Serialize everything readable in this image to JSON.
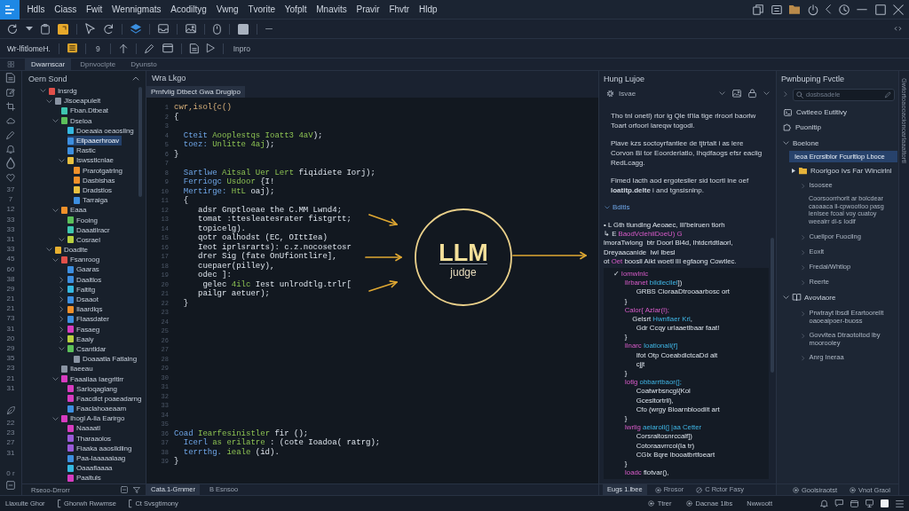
{
  "menu_bar": {
    "items": [
      "Hdls",
      "Ciass",
      "Fwit",
      "Wennigmats",
      "Acodiltyg",
      "Vwng",
      "Tvorite",
      "Yofplt",
      "Mnavits",
      "Pravir",
      "Fhvtr",
      "Hldp"
    ]
  },
  "toolbar": {
    "label": "Wr-lfitlomeH.",
    "counter": "9",
    "action": "Inpro"
  },
  "view_tabs": [
    {
      "label": "Dwarnscar",
      "selected": true
    },
    {
      "label": "Dpnvoclpte",
      "selected": false
    },
    {
      "label": "Dyunsto",
      "selected": false
    }
  ],
  "rail": {
    "numbers": [
      "37",
      "7",
      "12",
      "33",
      "33",
      "31",
      "33",
      "45",
      "60",
      "38",
      "29",
      "21",
      "21",
      "73",
      "31",
      "20",
      "29",
      "35",
      "23",
      "21",
      "31"
    ],
    "more_numbers": [
      "22",
      "23",
      "27",
      "31"
    ],
    "footer": "0 r"
  },
  "explorer": {
    "title": "Oern Sond",
    "footer": "Rseoo-Drrorr",
    "tree": [
      {
        "label": "Insrdg",
        "color": "#e0504a",
        "selected": false,
        "expanded": true,
        "children": [
          {
            "label": "Jlsoeapulelt",
            "color": "#8a94a3",
            "selected": false,
            "expanded": true,
            "children": [
              {
                "label": "Fban.Dtbeat",
                "color": "#3ec6b0",
                "selected": false
              },
              {
                "label": "Dseloa",
                "color": "#5cbf5a",
                "selected": false,
                "expanded": true,
                "children": [
                  {
                    "label": "Doeaaia oeaosllng",
                    "color": "#35b8e0",
                    "selected": false
                  },
                  {
                    "label": "Ellpaaerhroav",
                    "color": "#3d8fe0",
                    "selected": true
                  },
                  {
                    "label": "Rastic",
                    "color": "#3d8fe0",
                    "selected": false
                  },
                  {
                    "label": "Iswsstlcnlae",
                    "color": "#e8c040",
                    "selected": false,
                    "expanded": true,
                    "children": [
                      {
                        "label": "Prarotgatrlng",
                        "color": "#f0902a",
                        "selected": false
                      },
                      {
                        "label": "Dasbishas",
                        "color": "#f0902a",
                        "selected": false
                      },
                      {
                        "label": "Dradstlos",
                        "color": "#e8c040",
                        "selected": false
                      },
                      {
                        "label": "Tarraiga",
                        "color": "#3d8fe0",
                        "selected": false
                      }
                    ]
                  }
                ]
              },
              {
                "label": "Eaaa",
                "color": "#f0902a",
                "selected": false,
                "expanded": true,
                "children": [
                  {
                    "label": "Fooing",
                    "color": "#5cbf5a",
                    "selected": false
                  },
                  {
                    "label": "Daaatilracr",
                    "color": "#3ec6b0",
                    "selected": false
                  },
                  {
                    "label": "Cosrael",
                    "color": "#b8d040",
                    "selected": false,
                    "expanded": true
                  }
                ]
              }
            ]
          },
          {
            "label": "Doadlte",
            "color": "#e8b030",
            "selected": false,
            "expanded": true,
            "children": [
              {
                "label": "Fsanroog",
                "color": "#e0504a",
                "selected": false,
                "expanded": true,
                "children": [
                  {
                    "label": "Gaaras",
                    "color": "#3d8fe0",
                    "selected": false
                  },
                  {
                    "label": "Daaltlos",
                    "color": "#3d8fe0",
                    "selected": false,
                    "expanded": false
                  },
                  {
                    "label": "Faltitg",
                    "color": "#35b8e0",
                    "selected": false,
                    "expanded": false
                  },
                  {
                    "label": "Dsaaot",
                    "color": "#3d8fe0",
                    "selected": false,
                    "expanded": false
                  },
                  {
                    "label": "Ilaardlqs",
                    "color": "#f0902a",
                    "selected": false,
                    "expanded": false
                  },
                  {
                    "label": "Flaasdater",
                    "color": "#3d8fe0",
                    "selected": false,
                    "expanded": false
                  },
                  {
                    "label": "Fasaeg",
                    "color": "#d63cc0",
                    "selected": false,
                    "expanded": false
                  },
                  {
                    "label": "Eaaiy",
                    "color": "#b8d040",
                    "selected": false,
                    "expanded": false
                  },
                  {
                    "label": "Csantldar",
                    "color": "#5cbf5a",
                    "selected": false,
                    "expanded": true,
                    "children": [
                      {
                        "label": "Doaaatla Fatlalng",
                        "color": "#8a94a3",
                        "selected": false
                      }
                    ]
                  }
                ]
              },
              {
                "label": "Ilaeeau",
                "color": "#8a94a3",
                "selected": false
              },
              {
                "label": "Faaallaa Iaegrltlrr",
                "color": "#d63cc0",
                "selected": false,
                "expanded": true,
                "children": [
                  {
                    "label": "Sarloqaglang",
                    "color": "#d63cc0",
                    "selected": false
                  },
                  {
                    "label": "Faacdlct poaeadarng",
                    "color": "#d63cc0",
                    "selected": false
                  },
                  {
                    "label": "Faaclahoaeaam",
                    "color": "#3d8fe0",
                    "selected": false
                  }
                ]
              },
              {
                "label": "Ihogl A-lla Earirgo",
                "color": "#d63cc0",
                "selected": false,
                "expanded": true,
                "children": [
                  {
                    "label": "Naaaatl",
                    "color": "#d63cc0",
                    "selected": false
                  },
                  {
                    "label": "Tharaaolos",
                    "color": "#9a5ad8",
                    "selected": false
                  },
                  {
                    "label": "Fiaaka aaoslldling",
                    "color": "#9a5ad8",
                    "selected": false
                  },
                  {
                    "label": "Paa-Iaaaaalaag",
                    "color": "#3d8fe0",
                    "selected": false
                  },
                  {
                    "label": "Oaaaflaaaa",
                    "color": "#35b8e0",
                    "selected": false
                  },
                  {
                    "label": "Paaltuls",
                    "color": "#d63cc0",
                    "selected": false
                  }
                ]
              }
            ]
          }
        ]
      }
    ]
  },
  "editor": {
    "title": "Wra Lkgo",
    "tab": "Prnfvlig Dtbect Gwa Drugipo",
    "lines": [
      {
        "num": "1",
        "tokens": [
          {
            "text": "cwr,isol{c()",
            "kind": "acc"
          }
        ]
      },
      {
        "num": "2",
        "tokens": [
          {
            "text": "{",
            "kind": "pl"
          }
        ]
      },
      {
        "num": "3"
      },
      {
        "num": "4",
        "tokens": [
          {
            "text": "  Cteit ",
            "kind": "kw"
          },
          {
            "text": "Aooplestqs Ioatt3 4aV",
            "kind": "fn"
          },
          {
            "text": ");",
            "kind": "pl"
          }
        ]
      },
      {
        "num": "5",
        "tokens": [
          {
            "text": "  toez: ",
            "kind": "kw"
          },
          {
            "text": "Unlitte 4aj",
            "kind": "fn"
          },
          {
            "text": ");",
            "kind": "pl"
          }
        ]
      },
      {
        "num": "6",
        "tokens": [
          {
            "text": "}",
            "kind": "pl"
          }
        ]
      },
      {
        "num": "7"
      },
      {
        "num": "8",
        "tokens": [
          {
            "text": "  Sartlwe ",
            "kind": "kw"
          },
          {
            "text": "Aitsal Uer Lert",
            "kind": "fn"
          },
          {
            "text": " fiqidiete Iorj);",
            "kind": "pl"
          }
        ]
      },
      {
        "num": "9",
        "tokens": [
          {
            "text": "  Ferriogc ",
            "kind": "kw"
          },
          {
            "text": "Usdoor",
            "kind": "fn"
          },
          {
            "text": " {I!",
            "kind": "pl"
          }
        ]
      },
      {
        "num": "10",
        "tokens": [
          {
            "text": "  Mertirge: ",
            "kind": "kw"
          },
          {
            "text": "HtL",
            "kind": "fn"
          },
          {
            "text": " oaj);",
            "kind": "pl"
          }
        ]
      },
      {
        "num": "11",
        "tokens": [
          {
            "text": "  {",
            "kind": "pl"
          }
        ]
      },
      {
        "num": "12",
        "tokens": [
          {
            "text": "     adsr Gnptloeae the C.MM Lwnd4;",
            "kind": "pl"
          }
        ]
      },
      {
        "num": "13",
        "tokens": [
          {
            "text": "     tomat :ttesleatesrater fistgrtt;",
            "kind": "pl"
          }
        ]
      },
      {
        "num": "14",
        "tokens": [
          {
            "text": "     topicelg).",
            "kind": "pl"
          }
        ]
      },
      {
        "num": "15",
        "tokens": [
          {
            "text": "     qotr oalhodst (EC, OIttIea)",
            "kind": "pl"
          }
        ]
      },
      {
        "num": "16",
        "tokens": [
          {
            "text": "     Ieot iprlsrarts): c.z.nocosetosr",
            "kind": "pl"
          }
        ]
      },
      {
        "num": "17",
        "tokens": [
          {
            "text": "     drer Sig (fate OnUfiontlire],",
            "kind": "pl"
          }
        ]
      },
      {
        "num": "18",
        "tokens": [
          {
            "text": "     cuepaer(pilley),",
            "kind": "pl"
          }
        ]
      },
      {
        "num": "19",
        "tokens": [
          {
            "text": "     odec ]:",
            "kind": "pl"
          }
        ]
      },
      {
        "num": "20",
        "tokens": [
          {
            "text": "      gelec ",
            "kind": "pl"
          },
          {
            "text": "4ilc",
            "kind": "fn"
          },
          {
            "text": " Iest unlrodtlg.trlr[",
            "kind": "pl"
          }
        ]
      },
      {
        "num": "21",
        "tokens": [
          {
            "text": "     pailgr aetuer);",
            "kind": "pl"
          }
        ]
      },
      {
        "num": "22",
        "tokens": [
          {
            "text": "  }",
            "kind": "pl"
          }
        ]
      },
      {
        "num": "23"
      },
      {
        "num": "24"
      },
      {
        "num": "25"
      },
      {
        "num": "26"
      },
      {
        "num": "27"
      },
      {
        "num": "28"
      },
      {
        "num": "29"
      },
      {
        "num": "30"
      },
      {
        "num": "31"
      },
      {
        "num": "32"
      },
      {
        "num": "33"
      },
      {
        "num": "34"
      },
      {
        "num": "35"
      },
      {
        "num": "36",
        "tokens": [
          {
            "text": "Coad ",
            "kind": "kw"
          },
          {
            "text": "Iearfesinistler",
            "kind": "fn"
          },
          {
            "text": " fir ();",
            "kind": "pl"
          }
        ]
      },
      {
        "num": "37",
        "tokens": [
          {
            "text": "  Icerl ",
            "kind": "kw"
          },
          {
            "text": "as erilatre",
            "kind": "fn"
          },
          {
            "text": " : (cote Ioadoa( ratrg);",
            "kind": "pl"
          }
        ]
      },
      {
        "num": "38",
        "tokens": [
          {
            "text": "  terrthg. ",
            "kind": "kw"
          },
          {
            "text": "ieale",
            "kind": "fn"
          },
          {
            "text": " (id).",
            "kind": "pl"
          }
        ]
      },
      {
        "num": "39",
        "tokens": [
          {
            "text": "}",
            "kind": "pl"
          }
        ]
      }
    ],
    "diagram": {
      "title": "LLM",
      "label": "judge"
    },
    "footer_tabs": [
      {
        "label": "Cata.1-Grnmer",
        "selected": true
      },
      {
        "label": "B Esnsoo",
        "selected": false
      }
    ]
  },
  "judge_panel": {
    "title": "Hung Lujoe",
    "mode": "Isvae",
    "paragraphs": [
      "Tho tnl onetl) rtor ig Qle tl'ila tige rlroorl baorlw Toart orfoorl lareqw togodl.",
      "Plave kzs soctoyrfantlee de tjtrtalt i as lere Corvon Bl tor Eoorderlatlo, Ihqdfaogs efsr eaclig RedLcagg.",
      "Fimed Iacth aod ergoteslier sid tocrtl lne oef **loatitp.delte** i and tgnsisnlnp."
    ],
    "section": {
      "label": "Bdltls",
      "expanded": true
    },
    "notes": [
      [
        {
          "text": "• L Gth tlundlng Aeoaec, IIl'beiruen tlorh",
          "kind": "pl"
        }
      ],
      [
        {
          "text": "↳ E ",
          "kind": "pl"
        },
        {
          "text": "BaodVclehiiDoeU) G",
          "kind": "kw"
        }
      ],
      [
        {
          "text": "lmoraTwlong  btr Doorl Bl4d, Ihtdcrtdtlaorl,",
          "kind": "pl"
        }
      ],
      [
        {
          "text": "Dreyaacanlde  Iwl Ibesl",
          "kind": "pl"
        }
      ],
      [
        {
          "text": "ot ",
          "kind": "pl"
        },
        {
          "text": "Oet",
          "kind": "kw"
        },
        {
          "text": " boosll Aikt woetl lII egfaong Cowtlec.",
          "kind": "pl"
        }
      ]
    ],
    "code": [
      [
        {
          "text": "  ✓ ",
          "kind": "pl"
        },
        {
          "text": "Iomwlnlc",
          "kind": "kw"
        }
      ],
      [
        {
          "text": "     Ilrbanet ",
          "kind": "kw"
        },
        {
          "text": "bildlecllel",
          "kind": "fn"
        },
        {
          "text": "])",
          "kind": "pl"
        }
      ],
      [
        {
          "text": "        GRBS CioraaDtrooaarbosc ort",
          "kind": "pl"
        }
      ],
      [
        {
          "text": "     }",
          "kind": "pl"
        }
      ],
      [
        {
          "text": "     Calor{ Azlar(I);",
          "kind": "kw"
        }
      ],
      [
        {
          "text": "       Gelsrt ",
          "kind": "pl"
        },
        {
          "text": "Hwnflaer Krl",
          "kind": "fn"
        },
        {
          "text": ",",
          "kind": "pl"
        }
      ],
      [
        {
          "text": "        Gdr Ccqy urlaaetlbaar faat!",
          "kind": "pl"
        }
      ],
      [
        {
          "text": "     }",
          "kind": "pl"
        }
      ],
      [
        {
          "text": "     Ilnarc ",
          "kind": "kw"
        },
        {
          "text": "Ioationall(f]",
          "kind": "fn"
        }
      ],
      [
        {
          "text": "        Ifot Otp CoeabdlctcaDd alt",
          "kind": "pl"
        }
      ],
      [
        {
          "text": "        cjjt",
          "kind": "pl"
        }
      ],
      [
        {
          "text": "     }",
          "kind": "pl"
        }
      ],
      [
        {
          "text": "     Iotlg ",
          "kind": "kw"
        },
        {
          "text": "obbarrtbaor(];",
          "kind": "fn"
        }
      ],
      [
        {
          "text": "        Coatwrbsncgl{Kol",
          "kind": "pl"
        }
      ],
      [
        {
          "text": "        Gcesltortrll),",
          "kind": "pl"
        }
      ],
      [
        {
          "text": "        Cfo (wrgy Bloarnbloodilt art",
          "kind": "pl"
        }
      ],
      [
        {
          "text": "     }",
          "kind": "pl"
        }
      ],
      [
        {
          "text": "     Iwrlig ",
          "kind": "kw"
        },
        {
          "text": "aeiaroll(] |aa Cetter",
          "kind": "fn"
        }
      ],
      [
        {
          "text": "        Corsraltosnrccalf])",
          "kind": "pl"
        }
      ],
      [
        {
          "text": "        Cotoraavrrcol(Ia tr)",
          "kind": "pl"
        }
      ],
      [
        {
          "text": "        CGlx Bqre lbooatbrtfoeart",
          "kind": "pl"
        }
      ],
      [
        {
          "text": "     }",
          "kind": "pl"
        }
      ],
      [
        {
          "text": "     Ioadc ",
          "kind": "kw"
        },
        {
          "text": "flotvar(),",
          "kind": "pl"
        }
      ]
    ],
    "footer_tabs": [
      {
        "label": "Eugs 1.lbee",
        "kind": "plain",
        "selected": true
      },
      {
        "label": "Rrosor",
        "kind": "dot",
        "selected": false
      },
      {
        "label": "C Rctor Fasy",
        "kind": "ban",
        "selected": false
      }
    ]
  },
  "outline_panel": {
    "title": "Pwnbuping Fvctle",
    "search": {
      "placeholder": "dosbsadele"
    },
    "items": [
      {
        "kind": "console",
        "label": "Cwtleeo Eutltivy",
        "selected": false
      },
      {
        "kind": "plugin",
        "label": "Puonltip",
        "selected": false
      },
      {
        "kind": "section",
        "label": "Boelone",
        "expanded": true,
        "children": [
          {
            "kind": "entry",
            "label": "Ieoa Ercrslblor Fcurltlop Lboce",
            "selected": true
          },
          {
            "kind": "folder",
            "label": "Roorlgoo Ivs Far Wlncirlnl",
            "expanded": false,
            "selected": false
          },
          {
            "kind": "branch",
            "label": "Isoosee",
            "expanded": false,
            "selected": false
          },
          {
            "kind": "note",
            "label": "Coorsoorrhorlt ar bolcdear caoaaca ll-cpwootloo pasg lenlsee fcoal voy cuatoy weealrr dl-s Iodlf"
          },
          {
            "kind": "branch",
            "label": "Cuellpor Fuocilng",
            "expanded": false,
            "selected": false
          },
          {
            "kind": "branch",
            "label": "Eoxlt",
            "expanded": false,
            "selected": false
          },
          {
            "kind": "branch",
            "label": "Fredal/Whtlop",
            "expanded": false,
            "selected": false
          },
          {
            "kind": "branch",
            "label": "Reerte",
            "expanded": false,
            "selected": false
          }
        ]
      },
      {
        "kind": "library",
        "label": "Avovlaore",
        "expanded": true,
        "children": [
          {
            "kind": "branch",
            "label": "Prwtrayt lbsdl Erartoorellt oaoeaipoer-buoss",
            "expanded": false,
            "selected": false
          },
          {
            "kind": "branch",
            "label": "Govvltea Dtraotoltod lby moorooley",
            "expanded": false,
            "selected": false
          },
          {
            "kind": "branch",
            "label": "Anrg Ineraa",
            "expanded": false,
            "selected": false
          }
        ]
      }
    ],
    "footer": [
      {
        "label": "Goolsiraotst",
        "kind": "dot"
      },
      {
        "label": "Vnot Graol",
        "kind": "dot"
      }
    ]
  },
  "side_tab": {
    "label": "Gwtortoaooacionoarlaaaltortl"
  },
  "status_bar": {
    "left": [
      {
        "label": "Llaxulte Ghor",
        "kind": "plain"
      },
      {
        "label": "Ghorwh Rwwmse",
        "kind": "bracket"
      },
      {
        "label": "Ct Svsgtimony",
        "kind": "bracket"
      }
    ],
    "right": [
      {
        "label": "Ttrer",
        "kind": "dot"
      },
      {
        "label": "Dacnae 1lbs",
        "kind": "dot"
      },
      {
        "label": "Nwwoott",
        "kind": "plain"
      }
    ]
  }
}
